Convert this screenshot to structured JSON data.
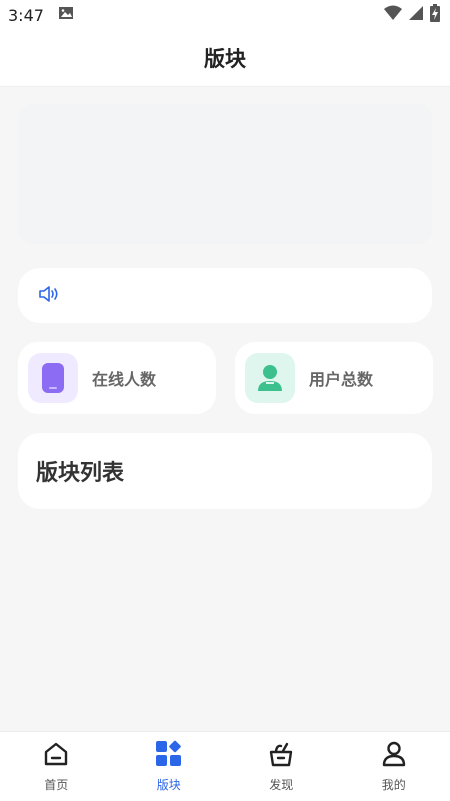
{
  "status_bar": {
    "time": "3:47"
  },
  "header": {
    "title": "版块"
  },
  "stats": {
    "online_label": "在线人数",
    "users_label": "用户总数"
  },
  "board_list": {
    "title": "版块列表"
  },
  "tabs": [
    {
      "label": "首页",
      "icon": "home-icon",
      "active": false
    },
    {
      "label": "版块",
      "icon": "grid-icon",
      "active": true
    },
    {
      "label": "发现",
      "icon": "discover-icon",
      "active": false
    },
    {
      "label": "我的",
      "icon": "profile-icon",
      "active": false
    }
  ],
  "colors": {
    "accent": "#2b66e8",
    "online_icon": "#8b6cf2",
    "users_icon": "#3cc18e"
  }
}
